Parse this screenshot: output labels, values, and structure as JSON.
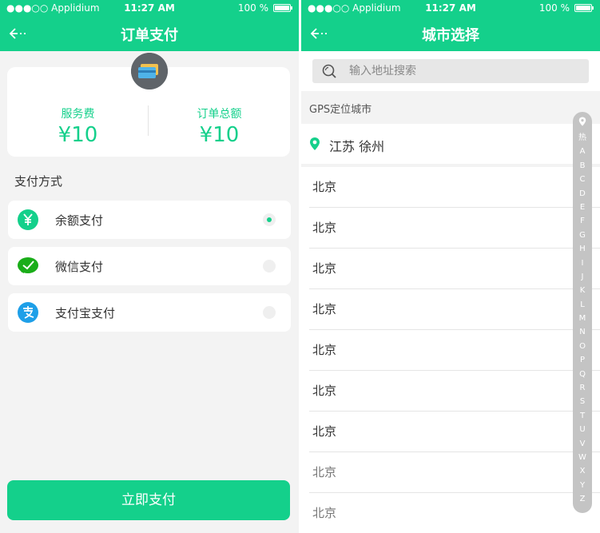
{
  "status_bar": {
    "carrier": "●●●○○ Applidium",
    "time": "11:27 AM",
    "battery": "100 %"
  },
  "payment_screen": {
    "title": "订单支付",
    "service_fee": {
      "label": "服务费",
      "value": "¥10"
    },
    "order_total": {
      "label": "订单总额",
      "value": "¥10"
    },
    "section_label": "支付方式",
    "methods": [
      {
        "label": "余额支付",
        "icon": "yuan-balance-icon",
        "selected": true,
        "color": "#14d08b"
      },
      {
        "label": "微信支付",
        "icon": "wechat-icon",
        "selected": false,
        "color": "#1aad19"
      },
      {
        "label": "支付宝支付",
        "icon": "alipay-icon",
        "selected": false,
        "color": "#1e9fe8"
      }
    ],
    "submit_label": "立即支付"
  },
  "city_screen": {
    "title": "城市选择",
    "search_placeholder": "输入地址搜索",
    "gps_label": "GPS定位城市",
    "gps_city": "江苏 徐州",
    "cities": [
      "北京",
      "北京",
      "北京",
      "北京",
      "北京",
      "北京",
      "北京",
      "北京",
      "北京"
    ],
    "index_letters": [
      "热",
      "A",
      "B",
      "C",
      "D",
      "E",
      "F",
      "G",
      "H",
      "I",
      "J",
      "K",
      "L",
      "M",
      "N",
      "O",
      "P",
      "Q",
      "R",
      "S",
      "T",
      "U",
      "V",
      "W",
      "X",
      "Y",
      "Z"
    ]
  },
  "colors": {
    "accent": "#14d08b",
    "background": "#f3f3f3",
    "index_bar": "#c4c4c4"
  }
}
